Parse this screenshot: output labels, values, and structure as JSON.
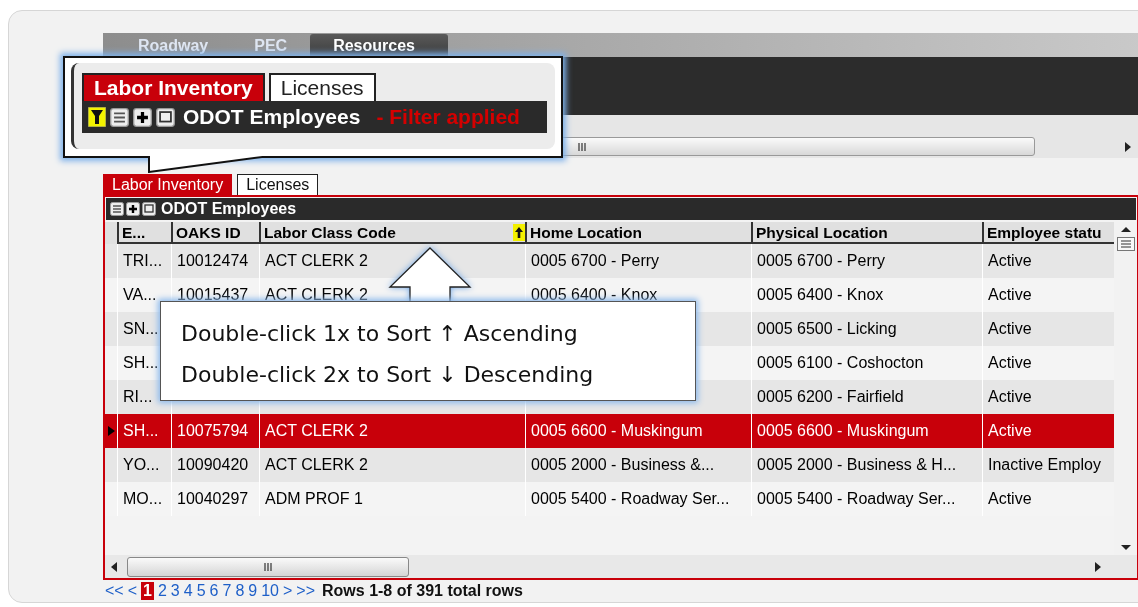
{
  "nav_tabs": [
    {
      "label": "Roadway",
      "selected": false
    },
    {
      "label": "PEC",
      "selected": false
    },
    {
      "label": "Resources",
      "selected": true
    }
  ],
  "zoom_callout": {
    "tabs": [
      {
        "label": "Labor Inventory",
        "selected": true
      },
      {
        "label": "Licenses",
        "selected": false
      }
    ],
    "filter_applied": true,
    "title": "ODOT Employees",
    "filter_note": "- Filter applied"
  },
  "tabs": [
    {
      "label": "Labor Inventory",
      "selected": true
    },
    {
      "label": "Licenses",
      "selected": false
    }
  ],
  "panel": {
    "title": "ODOT Employees"
  },
  "table": {
    "columns": [
      {
        "label": "E...",
        "sorted": false
      },
      {
        "label": "OAKS ID",
        "sorted": false
      },
      {
        "label": "Labor Class Code",
        "sorted": true
      },
      {
        "label": "Home Location",
        "sorted": false
      },
      {
        "label": "Physical Location",
        "sorted": false
      },
      {
        "label": "Employee statu",
        "sorted": false
      }
    ],
    "rows": [
      {
        "selected": false,
        "cells": [
          "TRI...",
          "10012474",
          "ACT CLERK 2",
          "0005 6700 - Perry",
          "0005 6700 - Perry",
          "Active"
        ]
      },
      {
        "selected": false,
        "cells": [
          "VA...",
          "10015437",
          "ACT CLERK 2",
          "0005 6400 - Knox",
          "0005 6400 - Knox",
          "Active"
        ]
      },
      {
        "selected": false,
        "cells": [
          "SN...",
          null,
          null,
          null,
          "0005 6500 - Licking",
          "Active"
        ]
      },
      {
        "selected": false,
        "cells": [
          "SH...",
          null,
          null,
          null,
          "0005 6100 - Coshocton",
          "Active"
        ]
      },
      {
        "selected": false,
        "cells": [
          "RI...",
          null,
          null,
          null,
          "0005 6200 - Fairfield",
          "Active"
        ]
      },
      {
        "selected": true,
        "cells": [
          "SH...",
          "10075794",
          "ACT CLERK 2",
          "0005 6600 - Muskingum",
          "0005 6600 - Muskingum",
          "Active"
        ]
      },
      {
        "selected": false,
        "cells": [
          "YO...",
          "10090420",
          "ACT CLERK 2",
          "0005 2000 - Business &...",
          "0005 2000 - Business & H...",
          "Inactive Employ"
        ]
      },
      {
        "selected": false,
        "cells": [
          "MO...",
          "10040297",
          "ADM PROF 1",
          "0005 5400 - Roadway Ser...",
          "0005 5400 - Roadway Ser...",
          "Active"
        ]
      }
    ]
  },
  "pagination": {
    "first": "<<",
    "prev": "<",
    "pages": [
      {
        "label": "1",
        "selected": true
      },
      {
        "label": "2",
        "selected": false
      },
      {
        "label": "3",
        "selected": false
      },
      {
        "label": "4",
        "selected": false
      },
      {
        "label": "5",
        "selected": false
      },
      {
        "label": "6",
        "selected": false
      },
      {
        "label": "7",
        "selected": false
      },
      {
        "label": "8",
        "selected": false
      },
      {
        "label": "9",
        "selected": false
      },
      {
        "label": "10",
        "selected": false
      }
    ],
    "next": ">",
    "last": ">>",
    "summary": "Rows 1-8 of 391 total rows"
  },
  "sort_tooltip": {
    "lines": [
      "Double-click 1x to Sort ↑ Ascending",
      "Double-click 2x to Sort ↓ Descending"
    ]
  }
}
